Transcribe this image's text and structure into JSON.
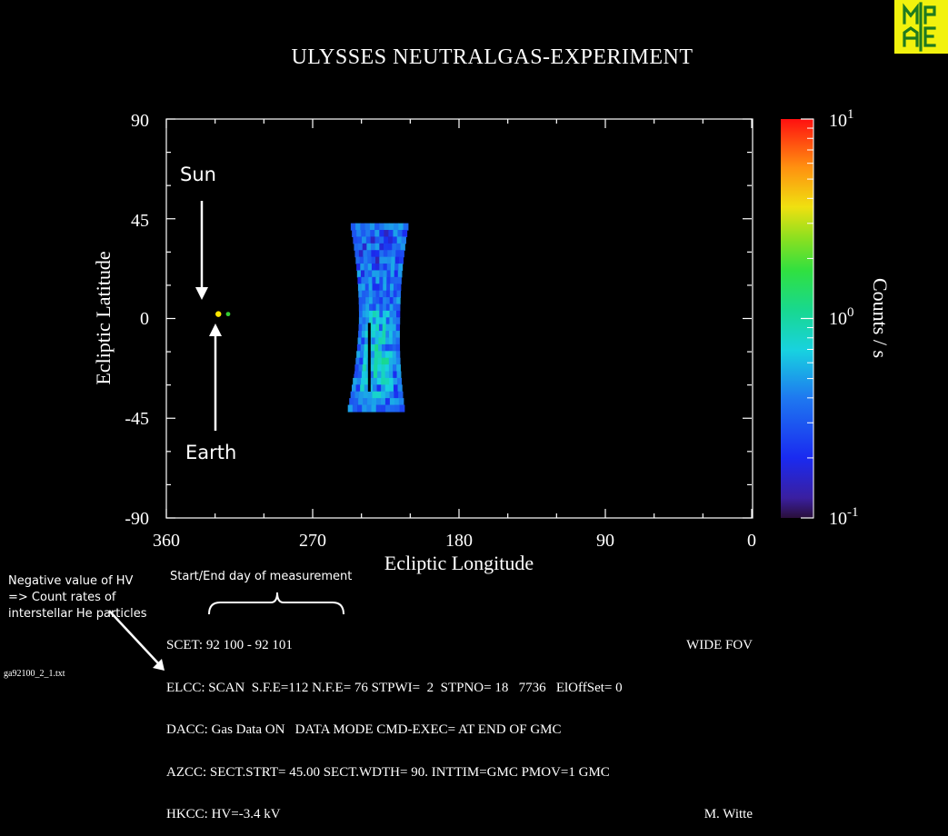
{
  "logo": {
    "text": "MPAE"
  },
  "title": "ULYSSES NEUTRALGAS-EXPERIMENT",
  "chart_data": {
    "type": "heatmap",
    "title": "ULYSSES NEUTRALGAS-EXPERIMENT",
    "xlabel": "Ecliptic Longitude",
    "ylabel": "Ecliptic Latitude",
    "xlim": [
      360,
      0
    ],
    "ylim": [
      -90,
      90
    ],
    "x_ticks": [
      "360",
      "270",
      "180",
      "90",
      "0"
    ],
    "y_ticks": [
      "90",
      "45",
      "0",
      "-45",
      "-90"
    ],
    "colorbar": {
      "label": "Counts / s",
      "scale": "log",
      "range": [
        0.1,
        10
      ],
      "ticks": [
        {
          "base": "10",
          "exp": "1"
        },
        {
          "base": "10",
          "exp": "0"
        },
        {
          "base": "10",
          "exp": "-1"
        }
      ]
    },
    "scan_region": {
      "lon_range": [
        211,
        247
      ],
      "lat_range": [
        -42,
        43
      ],
      "typical_counts": "0.2-0.6",
      "max_counts": 1.2
    },
    "markers": [
      {
        "label": "Sun",
        "lon": 328,
        "lat": 2,
        "color": "#ffe600"
      },
      {
        "label": "Earth",
        "lon": 322,
        "lat": 2,
        "color": "#33cc33"
      }
    ]
  },
  "annotations": {
    "sun": "Sun",
    "earth": "Earth",
    "hv_note": [
      "Negative value of HV",
      "=> Count rates of",
      "interstellar He particles"
    ],
    "start_end": "Start/End day of measurement"
  },
  "footer": {
    "scet": "SCET: 92 100 - 92 101",
    "wide_fov": "WIDE FOV",
    "elcc": "ELCC: SCAN  S.F.E=112 N.F.E= 76 STPWI=  2  STPNO= 18   7736   ElOffSet= 0",
    "dacc": "DACC: Gas Data ON   DATA MODE CMD-EXEC= AT END OF GMC",
    "azcc": "AZCC: SECT.STRT= 45.00 SECT.WDTH= 90. INTTIM=GMC PMOV=1 GMC",
    "hkcc": "HKCC: HV=-3.4 kV",
    "author": "M. Witte"
  },
  "filename": "ga92100_2_1.txt",
  "colors": {
    "background": "#000000",
    "axis": "#ffffff",
    "logo_bg": "#f2f20d",
    "logo_fg": "#1f7a1f"
  }
}
